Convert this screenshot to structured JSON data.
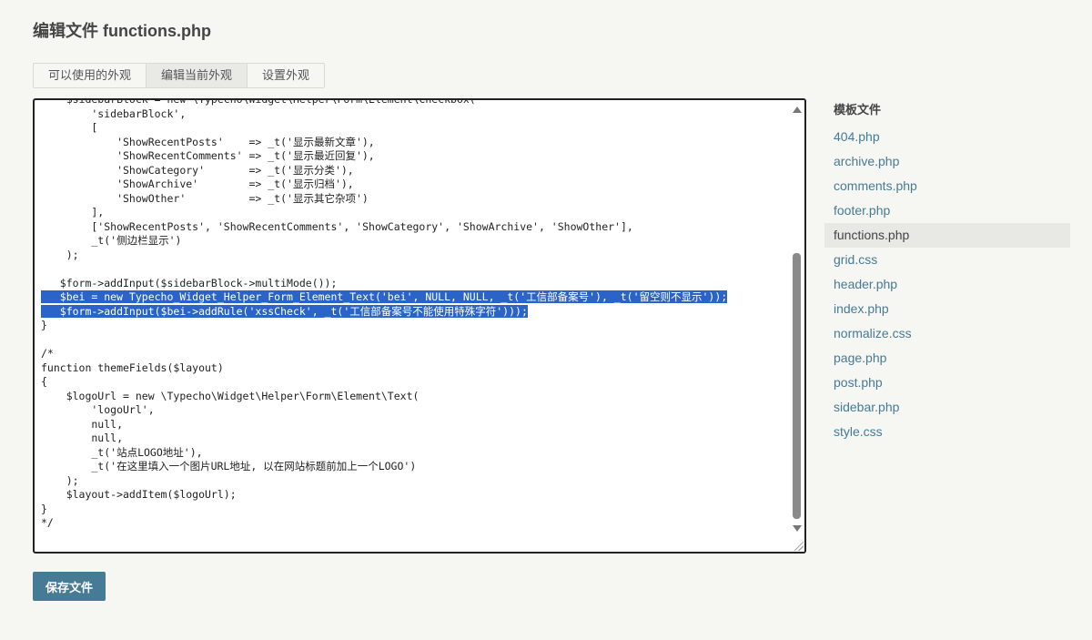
{
  "page": {
    "title": "编辑文件 functions.php"
  },
  "tabs": [
    {
      "label": "可以使用的外观",
      "active": false
    },
    {
      "label": "编辑当前外观",
      "active": true
    },
    {
      "label": "设置外观",
      "active": false
    }
  ],
  "editor": {
    "lines": [
      {
        "text": "    $sidebarBlock = new \\Typecho\\Widget\\Helper\\Form\\Element\\Checkbox(",
        "selected": false
      },
      {
        "text": "        'sidebarBlock',",
        "selected": false
      },
      {
        "text": "        [",
        "selected": false
      },
      {
        "text": "            'ShowRecentPosts'    => _t('显示最新文章'),",
        "selected": false
      },
      {
        "text": "            'ShowRecentComments' => _t('显示最近回复'),",
        "selected": false
      },
      {
        "text": "            'ShowCategory'       => _t('显示分类'),",
        "selected": false
      },
      {
        "text": "            'ShowArchive'        => _t('显示归档'),",
        "selected": false
      },
      {
        "text": "            'ShowOther'          => _t('显示其它杂项')",
        "selected": false
      },
      {
        "text": "        ],",
        "selected": false
      },
      {
        "text": "        ['ShowRecentPosts', 'ShowRecentComments', 'ShowCategory', 'ShowArchive', 'ShowOther'],",
        "selected": false
      },
      {
        "text": "        _t('侧边栏显示')",
        "selected": false
      },
      {
        "text": "    );",
        "selected": false
      },
      {
        "text": "",
        "selected": false
      },
      {
        "text": "   $form->addInput($sidebarBlock->multiMode());",
        "selected": false
      },
      {
        "text": "   $bei = new Typecho_Widget_Helper_Form_Element_Text('bei', NULL, NULL, _t('工信部备案号'), _t('留空则不显示'));",
        "selected": true
      },
      {
        "text": "   $form->addInput($bei->addRule('xssCheck', _t('工信部备案号不能使用特殊字符')));",
        "selected": true
      },
      {
        "text": "}",
        "selected": false
      },
      {
        "text": "",
        "selected": false
      },
      {
        "text": "/*",
        "selected": false
      },
      {
        "text": "function themeFields($layout)",
        "selected": false
      },
      {
        "text": "{",
        "selected": false
      },
      {
        "text": "    $logoUrl = new \\Typecho\\Widget\\Helper\\Form\\Element\\Text(",
        "selected": false
      },
      {
        "text": "        'logoUrl',",
        "selected": false
      },
      {
        "text": "        null,",
        "selected": false
      },
      {
        "text": "        null,",
        "selected": false
      },
      {
        "text": "        _t('站点LOGO地址'),",
        "selected": false
      },
      {
        "text": "        _t('在这里填入一个图片URL地址, 以在网站标题前加上一个LOGO')",
        "selected": false
      },
      {
        "text": "    );",
        "selected": false
      },
      {
        "text": "    $layout->addItem($logoUrl);",
        "selected": false
      },
      {
        "text": "}",
        "selected": false
      },
      {
        "text": "*/",
        "selected": false
      }
    ]
  },
  "save_button": {
    "label": "保存文件"
  },
  "sidebar": {
    "title": "模板文件",
    "files": [
      {
        "name": "404.php",
        "current": false
      },
      {
        "name": "archive.php",
        "current": false
      },
      {
        "name": "comments.php",
        "current": false
      },
      {
        "name": "footer.php",
        "current": false
      },
      {
        "name": "functions.php",
        "current": true
      },
      {
        "name": "grid.css",
        "current": false
      },
      {
        "name": "header.php",
        "current": false
      },
      {
        "name": "index.php",
        "current": false
      },
      {
        "name": "normalize.css",
        "current": false
      },
      {
        "name": "page.php",
        "current": false
      },
      {
        "name": "post.php",
        "current": false
      },
      {
        "name": "sidebar.php",
        "current": false
      },
      {
        "name": "style.css",
        "current": false
      }
    ]
  },
  "colors": {
    "accent": "#467b96",
    "selection": "#2a64c8",
    "background": "#f6f6f3"
  }
}
